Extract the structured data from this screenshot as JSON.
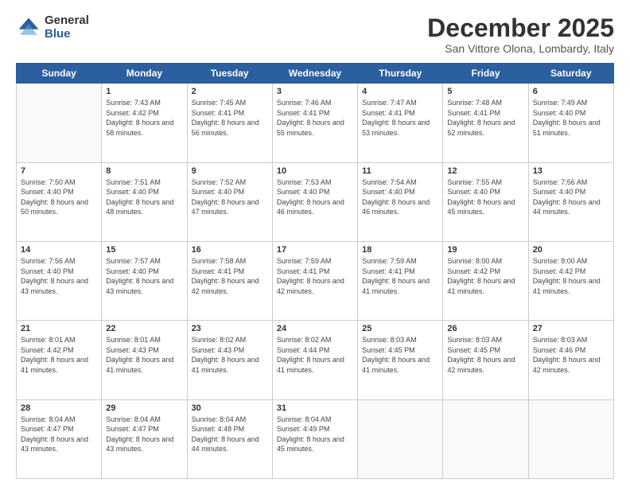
{
  "logo": {
    "general": "General",
    "blue": "Blue"
  },
  "title": {
    "month": "December 2025",
    "location": "San Vittore Olona, Lombardy, Italy"
  },
  "days_header": [
    "Sunday",
    "Monday",
    "Tuesday",
    "Wednesday",
    "Thursday",
    "Friday",
    "Saturday"
  ],
  "weeks": [
    [
      {
        "day": "",
        "sunrise": "",
        "sunset": "",
        "daylight": ""
      },
      {
        "day": "1",
        "sunrise": "Sunrise: 7:43 AM",
        "sunset": "Sunset: 4:42 PM",
        "daylight": "Daylight: 8 hours and 58 minutes."
      },
      {
        "day": "2",
        "sunrise": "Sunrise: 7:45 AM",
        "sunset": "Sunset: 4:41 PM",
        "daylight": "Daylight: 8 hours and 56 minutes."
      },
      {
        "day": "3",
        "sunrise": "Sunrise: 7:46 AM",
        "sunset": "Sunset: 4:41 PM",
        "daylight": "Daylight: 8 hours and 55 minutes."
      },
      {
        "day": "4",
        "sunrise": "Sunrise: 7:47 AM",
        "sunset": "Sunset: 4:41 PM",
        "daylight": "Daylight: 8 hours and 53 minutes."
      },
      {
        "day": "5",
        "sunrise": "Sunrise: 7:48 AM",
        "sunset": "Sunset: 4:41 PM",
        "daylight": "Daylight: 8 hours and 52 minutes."
      },
      {
        "day": "6",
        "sunrise": "Sunrise: 7:49 AM",
        "sunset": "Sunset: 4:40 PM",
        "daylight": "Daylight: 8 hours and 51 minutes."
      }
    ],
    [
      {
        "day": "7",
        "sunrise": "Sunrise: 7:50 AM",
        "sunset": "Sunset: 4:40 PM",
        "daylight": "Daylight: 8 hours and 50 minutes."
      },
      {
        "day": "8",
        "sunrise": "Sunrise: 7:51 AM",
        "sunset": "Sunset: 4:40 PM",
        "daylight": "Daylight: 8 hours and 48 minutes."
      },
      {
        "day": "9",
        "sunrise": "Sunrise: 7:52 AM",
        "sunset": "Sunset: 4:40 PM",
        "daylight": "Daylight: 8 hours and 47 minutes."
      },
      {
        "day": "10",
        "sunrise": "Sunrise: 7:53 AM",
        "sunset": "Sunset: 4:40 PM",
        "daylight": "Daylight: 8 hours and 46 minutes."
      },
      {
        "day": "11",
        "sunrise": "Sunrise: 7:54 AM",
        "sunset": "Sunset: 4:40 PM",
        "daylight": "Daylight: 8 hours and 46 minutes."
      },
      {
        "day": "12",
        "sunrise": "Sunrise: 7:55 AM",
        "sunset": "Sunset: 4:40 PM",
        "daylight": "Daylight: 8 hours and 45 minutes."
      },
      {
        "day": "13",
        "sunrise": "Sunrise: 7:56 AM",
        "sunset": "Sunset: 4:40 PM",
        "daylight": "Daylight: 8 hours and 44 minutes."
      }
    ],
    [
      {
        "day": "14",
        "sunrise": "Sunrise: 7:56 AM",
        "sunset": "Sunset: 4:40 PM",
        "daylight": "Daylight: 8 hours and 43 minutes."
      },
      {
        "day": "15",
        "sunrise": "Sunrise: 7:57 AM",
        "sunset": "Sunset: 4:40 PM",
        "daylight": "Daylight: 8 hours and 43 minutes."
      },
      {
        "day": "16",
        "sunrise": "Sunrise: 7:58 AM",
        "sunset": "Sunset: 4:41 PM",
        "daylight": "Daylight: 8 hours and 42 minutes."
      },
      {
        "day": "17",
        "sunrise": "Sunrise: 7:59 AM",
        "sunset": "Sunset: 4:41 PM",
        "daylight": "Daylight: 8 hours and 42 minutes."
      },
      {
        "day": "18",
        "sunrise": "Sunrise: 7:59 AM",
        "sunset": "Sunset: 4:41 PM",
        "daylight": "Daylight: 8 hours and 41 minutes."
      },
      {
        "day": "19",
        "sunrise": "Sunrise: 8:00 AM",
        "sunset": "Sunset: 4:42 PM",
        "daylight": "Daylight: 8 hours and 41 minutes."
      },
      {
        "day": "20",
        "sunrise": "Sunrise: 8:00 AM",
        "sunset": "Sunset: 4:42 PM",
        "daylight": "Daylight: 8 hours and 41 minutes."
      }
    ],
    [
      {
        "day": "21",
        "sunrise": "Sunrise: 8:01 AM",
        "sunset": "Sunset: 4:42 PM",
        "daylight": "Daylight: 8 hours and 41 minutes."
      },
      {
        "day": "22",
        "sunrise": "Sunrise: 8:01 AM",
        "sunset": "Sunset: 4:43 PM",
        "daylight": "Daylight: 8 hours and 41 minutes."
      },
      {
        "day": "23",
        "sunrise": "Sunrise: 8:02 AM",
        "sunset": "Sunset: 4:43 PM",
        "daylight": "Daylight: 8 hours and 41 minutes."
      },
      {
        "day": "24",
        "sunrise": "Sunrise: 8:02 AM",
        "sunset": "Sunset: 4:44 PM",
        "daylight": "Daylight: 8 hours and 41 minutes."
      },
      {
        "day": "25",
        "sunrise": "Sunrise: 8:03 AM",
        "sunset": "Sunset: 4:45 PM",
        "daylight": "Daylight: 8 hours and 41 minutes."
      },
      {
        "day": "26",
        "sunrise": "Sunrise: 8:03 AM",
        "sunset": "Sunset: 4:45 PM",
        "daylight": "Daylight: 8 hours and 42 minutes."
      },
      {
        "day": "27",
        "sunrise": "Sunrise: 8:03 AM",
        "sunset": "Sunset: 4:46 PM",
        "daylight": "Daylight: 8 hours and 42 minutes."
      }
    ],
    [
      {
        "day": "28",
        "sunrise": "Sunrise: 8:04 AM",
        "sunset": "Sunset: 4:47 PM",
        "daylight": "Daylight: 8 hours and 43 minutes."
      },
      {
        "day": "29",
        "sunrise": "Sunrise: 8:04 AM",
        "sunset": "Sunset: 4:47 PM",
        "daylight": "Daylight: 8 hours and 43 minutes."
      },
      {
        "day": "30",
        "sunrise": "Sunrise: 8:04 AM",
        "sunset": "Sunset: 4:48 PM",
        "daylight": "Daylight: 8 hours and 44 minutes."
      },
      {
        "day": "31",
        "sunrise": "Sunrise: 8:04 AM",
        "sunset": "Sunset: 4:49 PM",
        "daylight": "Daylight: 8 hours and 45 minutes."
      },
      {
        "day": "",
        "sunrise": "",
        "sunset": "",
        "daylight": ""
      },
      {
        "day": "",
        "sunrise": "",
        "sunset": "",
        "daylight": ""
      },
      {
        "day": "",
        "sunrise": "",
        "sunset": "",
        "daylight": ""
      }
    ]
  ]
}
